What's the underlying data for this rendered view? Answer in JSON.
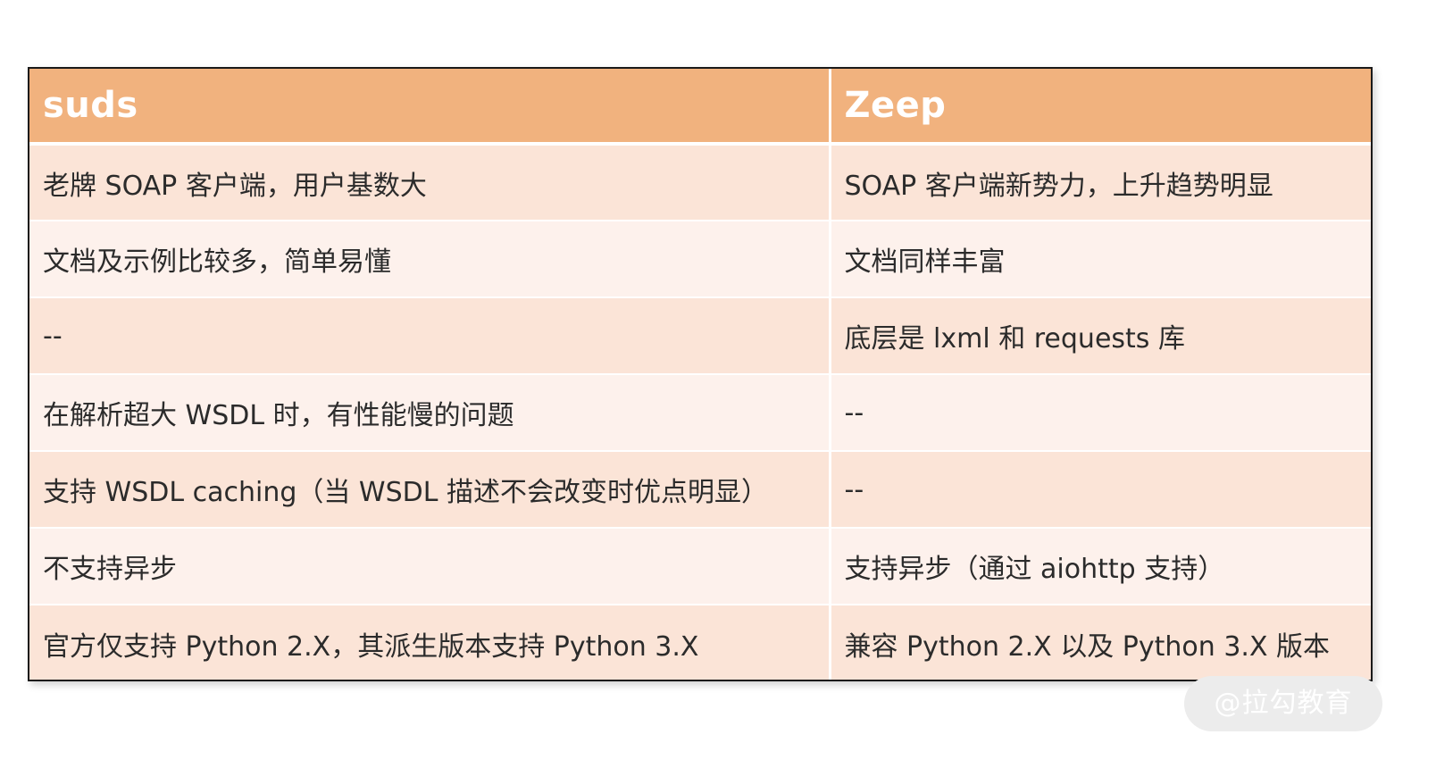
{
  "table": {
    "headers": [
      "suds",
      "Zeep"
    ],
    "rows": [
      [
        "老牌 SOAP 客户端，用户基数大",
        "SOAP 客户端新势力，上升趋势明显"
      ],
      [
        "文档及示例比较多，简单易懂",
        "文档同样丰富"
      ],
      [
        "--",
        "底层是 lxml 和 requests 库"
      ],
      [
        "在解析超大 WSDL 时，有性能慢的问题",
        "--"
      ],
      [
        "支持 WSDL caching（当 WSDL 描述不会改变时优点明显）",
        "--"
      ],
      [
        "不支持异步",
        "支持异步（通过 aiohttp 支持）"
      ],
      [
        "官方仅支持 Python 2.X，其派生版本支持 Python 3.X",
        "兼容 Python 2.X 以及 Python 3.X 版本"
      ]
    ]
  },
  "watermark": "@拉勾教育",
  "colors": {
    "header_bg": "#f1b27e",
    "row_odd_bg": "#fbe4d7",
    "row_even_bg": "#fdf1ec"
  }
}
